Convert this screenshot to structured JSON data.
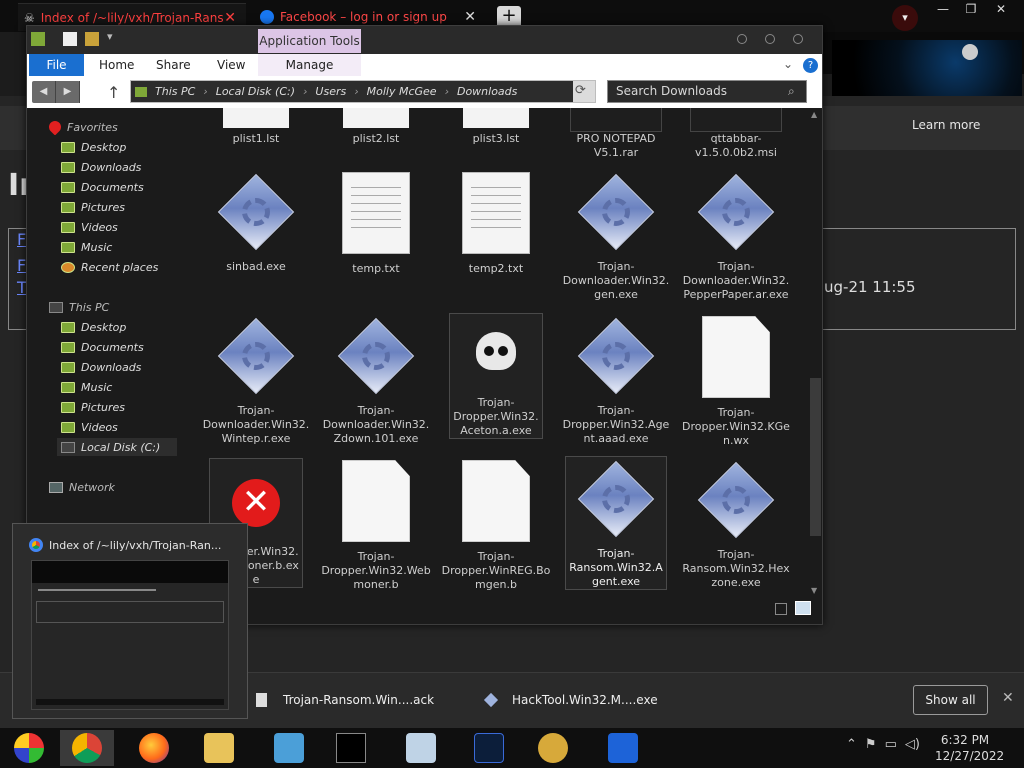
{
  "browser": {
    "tabs": [
      {
        "label": "Index of /~lily/vxh/Trojan-Rans",
        "close": "✕"
      },
      {
        "label": "Facebook – log in or sign up",
        "close": "✕"
      }
    ],
    "new_tab": "+",
    "learn_more": "Learn more",
    "behind_heading": "In",
    "behind_date": "ug-21 11:55",
    "behind_links": [
      "F",
      "F",
      "T"
    ]
  },
  "downloads_shelf": {
    "items": [
      "Trojan-Ransom.Win....ack",
      "HackTool.Win32.M....exe"
    ],
    "show_all": "Show all",
    "close": "✕"
  },
  "explorer": {
    "app_tools": "Application Tools",
    "ribbon_tabs": [
      "File",
      "Home",
      "Share",
      "View",
      "Manage"
    ],
    "address_path": [
      "This PC",
      "Local Disk (C:)",
      "Users",
      "Molly McGee",
      "Downloads"
    ],
    "search_placeholder": "Search Downloads",
    "nav": {
      "favorites": "Favorites",
      "favorites_items": [
        "Desktop",
        "Downloads",
        "Documents",
        "Pictures",
        "Videos",
        "Music",
        "Recent places"
      ],
      "this_pc": "This PC",
      "pc_items": [
        "Desktop",
        "Documents",
        "Downloads",
        "Music",
        "Pictures",
        "Videos",
        "Local Disk (C:)"
      ],
      "network": "Network"
    },
    "files_row0": [
      "plist1.lst",
      "plist2.lst",
      "plist3.lst",
      "PRO NOTEPAD V5.1.rar",
      "qttabbar-v1.5.0.0b2.msi"
    ],
    "files_row1": [
      "sinbad.exe",
      "temp.txt",
      "temp2.txt",
      "Trojan-Downloader.Win32.gen.exe",
      "Trojan-Downloader.Win32.PepperPaper.ar.exe"
    ],
    "files_row2": [
      "Trojan-Downloader.Win32.Wintep.r.exe",
      "Trojan-Downloader.Win32.Zdown.101.exe",
      "Trojan-Dropper.Win32.Aceton.a.exe",
      "Trojan-Dropper.Win32.Agent.aaad.exe",
      "Trojan-Dropper.Win32.KGen.wx"
    ],
    "files_row3": [
      "Dropper.Win32.Webmoner.b.exe",
      "Trojan-Dropper.Win32.Webmoner.b",
      "Trojan-Dropper.WinREG.Bomgen.b",
      "Trojan-Ransom.Win32.Agent.exe",
      "Trojan-Ransom.Win32.Hexzone.exe"
    ]
  },
  "thumbnail": {
    "title": "Index of /~lily/vxh/Trojan-Ran..."
  },
  "taskbar": {
    "clock_time": "6:32 PM",
    "clock_date": "12/27/2022"
  }
}
